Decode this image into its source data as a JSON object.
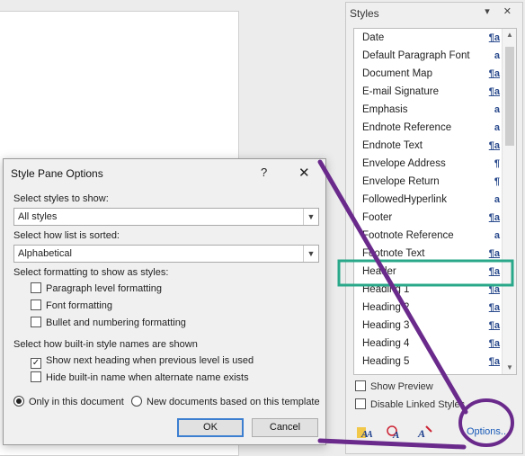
{
  "styles_pane": {
    "title": "Styles",
    "controls": "▾ ✕",
    "items": [
      {
        "name": "Date",
        "symbol": "¶a"
      },
      {
        "name": "Default Paragraph Font",
        "symbol": "a"
      },
      {
        "name": "Document Map",
        "symbol": "¶a"
      },
      {
        "name": "E-mail Signature",
        "symbol": "¶a"
      },
      {
        "name": "Emphasis",
        "symbol": "a"
      },
      {
        "name": "Endnote Reference",
        "symbol": "a"
      },
      {
        "name": "Endnote Text",
        "symbol": "¶a"
      },
      {
        "name": "Envelope Address",
        "symbol": "¶"
      },
      {
        "name": "Envelope Return",
        "symbol": "¶"
      },
      {
        "name": "FollowedHyperlink",
        "symbol": "a"
      },
      {
        "name": "Footer",
        "symbol": "¶a"
      },
      {
        "name": "Footnote Reference",
        "symbol": "a"
      },
      {
        "name": "Footnote Text",
        "symbol": "¶a"
      },
      {
        "name": "Header",
        "symbol": "¶a"
      },
      {
        "name": "Heading 1",
        "symbol": "¶a"
      },
      {
        "name": "Heading 2",
        "symbol": "¶a"
      },
      {
        "name": "Heading 3",
        "symbol": "¶a"
      },
      {
        "name": "Heading 4",
        "symbol": "¶a"
      },
      {
        "name": "Heading 5",
        "symbol": "¶a"
      }
    ],
    "show_preview_label": "Show Preview",
    "disable_linked_label": "Disable Linked Styles",
    "options_label": "Options...",
    "icons": [
      "new-style-icon",
      "style-inspector-icon",
      "manage-styles-icon"
    ]
  },
  "dialog": {
    "title": "Style Pane Options",
    "help": "?",
    "close": "✕",
    "select_styles_label": "Select styles to show:",
    "select_styles_value": "All styles",
    "sort_label": "Select how list is sorted:",
    "sort_value": "Alphabetical",
    "formatting_label": "Select formatting to show as styles:",
    "formatting_options": [
      {
        "label": "Paragraph level formatting",
        "checked": false
      },
      {
        "label": "Font formatting",
        "checked": false
      },
      {
        "label": "Bullet and numbering formatting",
        "checked": false
      }
    ],
    "builtin_label": "Select how built-in style names are shown",
    "builtin_options": [
      {
        "label": "Show next heading when previous level is used",
        "checked": true
      },
      {
        "label": "Hide built-in name when alternate name exists",
        "checked": false
      }
    ],
    "radio_this_doc": "Only in this document",
    "radio_new_docs": "New documents based on this template",
    "ok_label": "OK",
    "cancel_label": "Cancel"
  },
  "annotation_colors": {
    "highlight_box": "#2aa88a",
    "arrow": "#6a2a8c"
  }
}
